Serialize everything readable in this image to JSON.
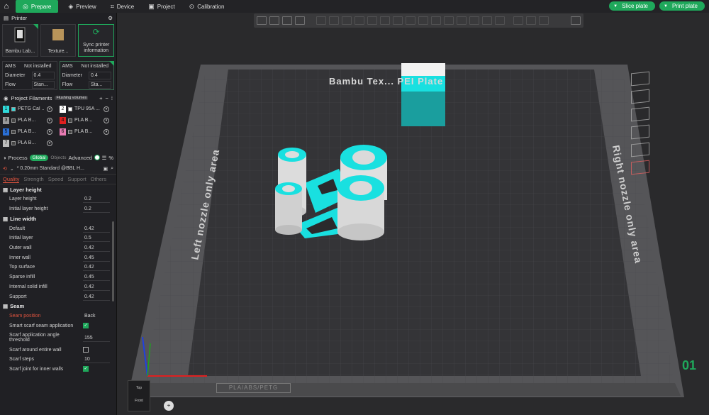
{
  "topbar": {
    "tabs": [
      {
        "label": "Prepare",
        "icon": "prepare-icon",
        "active": true
      },
      {
        "label": "Preview",
        "icon": "preview-icon"
      },
      {
        "label": "Device",
        "icon": "device-icon"
      },
      {
        "label": "Project",
        "icon": "project-icon"
      },
      {
        "label": "Calibration",
        "icon": "calibration-icon"
      }
    ],
    "slice_label": "Slice plate",
    "print_label": "Print plate"
  },
  "printer": {
    "title": "Printer",
    "cards": [
      {
        "label": "Bambu Lab..."
      },
      {
        "label": "Texture..."
      },
      {
        "label": "Sync printer information"
      }
    ],
    "ams": [
      {
        "ams_label": "AMS",
        "ams_value": "Not installed",
        "diameter_label": "Diameter",
        "diameter_value": "0.4",
        "flow_label": "Flow",
        "flow_value": "Stan..."
      },
      {
        "ams_label": "AMS",
        "ams_value": "Not installed",
        "diameter_label": "Diameter",
        "diameter_value": "0.4",
        "flow_label": "Flow",
        "flow_value": "Sta..."
      }
    ]
  },
  "filaments": {
    "title": "Project Filaments",
    "badge": "Flushing volumes",
    "items": [
      {
        "num": "1",
        "name": "PETG Cal ...",
        "num_color": "#2fd9d9",
        "swatch": "#2fd9d9"
      },
      {
        "num": "2",
        "name": "TPU 95A ...",
        "num_color": "#ffffff",
        "swatch": "#ffffff"
      },
      {
        "num": "3",
        "name": "PLA B...",
        "num_color": "#9a9a9a",
        "swatch": "#444444"
      },
      {
        "num": "4",
        "name": "PLA B...",
        "num_color": "#e02020",
        "swatch": "#444444"
      },
      {
        "num": "5",
        "name": "PLA B...",
        "num_color": "#2a6fd6",
        "swatch": "#444444"
      },
      {
        "num": "6",
        "name": "PLA B...",
        "num_color": "#e87bb3",
        "swatch": "#444444"
      },
      {
        "num": "7",
        "name": "PLA B...",
        "num_color": "#bdbdbd",
        "swatch": "#444444"
      }
    ]
  },
  "process": {
    "title": "Process",
    "global_label": "Global",
    "objects_label": "Objects",
    "advanced_label": "Advanced",
    "preset": "* 0.20mm Standard @BBL H...",
    "tabs": [
      "Quality",
      "Strength",
      "Speed",
      "Support",
      "Others"
    ],
    "groups": {
      "layer_height": {
        "title": "Layer height",
        "rows": [
          {
            "label": "Layer height",
            "value": "0.2"
          },
          {
            "label": "Initial layer height",
            "value": "0.2"
          }
        ]
      },
      "line_width": {
        "title": "Line width",
        "rows": [
          {
            "label": "Default",
            "value": "0.42"
          },
          {
            "label": "Initial layer",
            "value": "0.5"
          },
          {
            "label": "Outer wall",
            "value": "0.42"
          },
          {
            "label": "Inner wall",
            "value": "0.45"
          },
          {
            "label": "Top surface",
            "value": "0.42"
          },
          {
            "label": "Sparse infill",
            "value": "0.45"
          },
          {
            "label": "Internal solid infill",
            "value": "0.42"
          },
          {
            "label": "Support",
            "value": "0.42"
          }
        ]
      },
      "seam": {
        "title": "Seam",
        "seam_position_label": "Seam position",
        "seam_position_value": "Back",
        "smart_scarf_label": "Smart scarf seam application",
        "scarf_threshold_label": "Scarf application angle threshold",
        "scarf_threshold_value": "155",
        "scarf_around_label": "Scarf around entire wall",
        "scarf_steps_label": "Scarf steps",
        "scarf_steps_value": "10",
        "scarf_inner_label": "Scarf joint for inner walls"
      }
    }
  },
  "viewport": {
    "plate_title": "Bambu Tex... PEI Plate",
    "left_area": "Left nozzle only area",
    "right_area": "Right nozzle only area",
    "plate_number": "01",
    "plate_type": "PLA/ABS/PETG",
    "cube_top": "Top",
    "cube_front": "Front",
    "colors": {
      "accent": "#1fa85b",
      "model_white": "#e8e8e8",
      "model_cyan": "#19e0e0",
      "bed": "#3a3a3c"
    }
  }
}
